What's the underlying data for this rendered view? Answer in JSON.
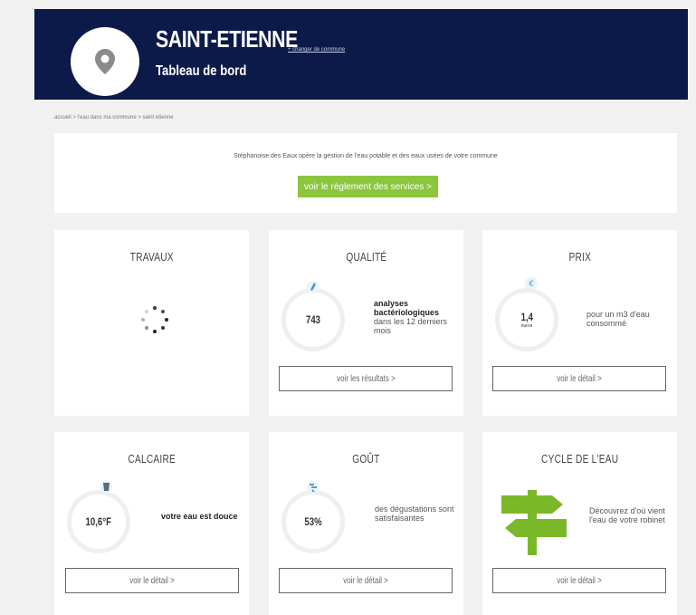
{
  "header": {
    "city": "SAINT-ETIENNE",
    "change_link": "+ changer de commune",
    "subtitle": "Tableau de bord"
  },
  "breadcrumb": "accueil > l'eau dans ma commune > saint etienne",
  "operator": {
    "text": "Stéphanoise des Eaux opère la gestion de l'eau potable et des eaux usées de votre commune",
    "button_label": "voir le règlement des services >"
  },
  "cards": {
    "travaux": {
      "title": "TRAVAUX"
    },
    "qualite": {
      "title": "QUALITÉ",
      "value": "743",
      "desc_bold": "analyses bactériologiques",
      "desc_rest": "dans les 12 derniers mois",
      "button_label": "voir les résultats >"
    },
    "prix": {
      "title": "PRIX",
      "value": "1,4",
      "unit": "euros",
      "desc": "pour un m3 d'eau consommé",
      "button_label": "voir le détail >"
    },
    "calcaire": {
      "title": "CALCAIRE",
      "value": "10,6°F",
      "desc": "votre eau est douce",
      "button_label": "voir le détail >"
    },
    "gout": {
      "title": "GOÛT",
      "value": "53%",
      "desc": "des dégustations sont satisfaisantes",
      "button_label": "voir le détail >"
    },
    "cycle": {
      "title": "CYCLE DE L'EAU",
      "desc": "Découvrez d'où vient l'eau de votre robinet",
      "button_label": "voir le détail >"
    }
  },
  "colors": {
    "header_bg": "#0c1a4a",
    "accent_green": "#8cc63f",
    "signpost_green": "#7ab829",
    "badge_blue": "#4aa3d6"
  },
  "icons": {
    "header": "location-pin-icon",
    "qualite": "test-tube-icon",
    "prix": "euro-icon",
    "calcaire": "glass-icon",
    "gout": "taste-icon",
    "cycle": "signpost-icon",
    "travaux": "loading-spinner-icon"
  }
}
